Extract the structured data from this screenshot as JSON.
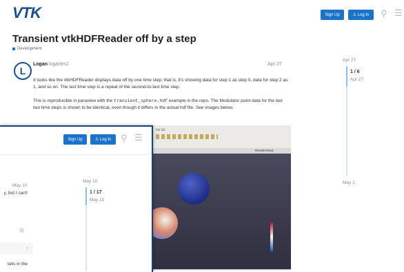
{
  "back": {
    "logo": "VTK",
    "signup_label": "Sign Up",
    "login_label": "Log In",
    "title": "Transient vtkHDFReader off by a step",
    "category": "Development",
    "avatar_letter": "L",
    "author_name": "Logan",
    "author_handle": "logantm2",
    "post_date": "Apr 27",
    "para1": "It looks like the vtkHDFReader displays data off by one time step; that is, it's showing data for step 1 as step 0, data for step 2 as 1, and so on. The last time step is a repeat of the second-to-last time step.",
    "para2_pre": "This is reproducible in paraview with the ",
    "para2_code": "transient_sphere.hdf",
    "para2_post": " example in the repo. The Modulator point data for the last two time steps is shown to be identical, even though it differs in the actual hdf file. See images below.",
    "timeline": {
      "top_date": "Apr 27",
      "count": "1 / 6",
      "count_date": "Apr 27",
      "bottom_date": "May 2"
    }
  },
  "front": {
    "signup_label": "Sign Up",
    "login_label": "Log In",
    "post_date": "May 10",
    "text1": "y, but I can't",
    "text2": "sets in the",
    "timeline": {
      "top_date": "May 10",
      "count": "1 / 17",
      "count_date": "May 10"
    }
  },
  "image": {
    "toolbar_text": "Ux Ux",
    "pane_label": "RenderView1"
  },
  "colors": {
    "brand": "#1b4e8f",
    "accent": "#1a73c8"
  }
}
